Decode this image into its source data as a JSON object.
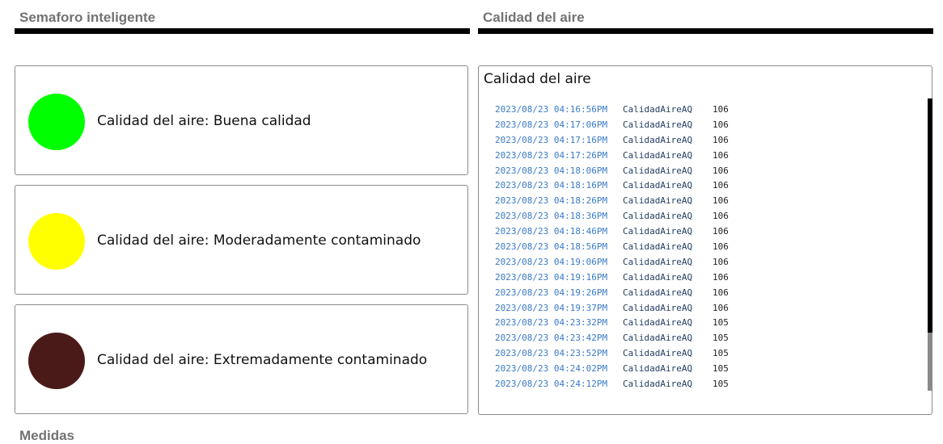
{
  "sections": {
    "left_title": "Semaforo inteligente",
    "right_title": "Calidad del aire",
    "bottom_title": "Medidas"
  },
  "traffic_light": [
    {
      "color": "#00ff00",
      "label": "Calidad del aire: Buena calidad"
    },
    {
      "color": "#ffff00",
      "label": "Calidad del aire: Moderadamente contaminado"
    },
    {
      "color": "#4a1a19",
      "label": "Calidad del aire: Extremadamente contaminado"
    }
  ],
  "log": {
    "title": "Calidad del aire",
    "rows": [
      {
        "ts": "2023/08/23 04:16:56PM",
        "name": "CalidadAireAQ",
        "value": "106"
      },
      {
        "ts": "2023/08/23 04:17:06PM",
        "name": "CalidadAireAQ",
        "value": "106"
      },
      {
        "ts": "2023/08/23 04:17:16PM",
        "name": "CalidadAireAQ",
        "value": "106"
      },
      {
        "ts": "2023/08/23 04:17:26PM",
        "name": "CalidadAireAQ",
        "value": "106"
      },
      {
        "ts": "2023/08/23 04:18:06PM",
        "name": "CalidadAireAQ",
        "value": "106"
      },
      {
        "ts": "2023/08/23 04:18:16PM",
        "name": "CalidadAireAQ",
        "value": "106"
      },
      {
        "ts": "2023/08/23 04:18:26PM",
        "name": "CalidadAireAQ",
        "value": "106"
      },
      {
        "ts": "2023/08/23 04:18:36PM",
        "name": "CalidadAireAQ",
        "value": "106"
      },
      {
        "ts": "2023/08/23 04:18:46PM",
        "name": "CalidadAireAQ",
        "value": "106"
      },
      {
        "ts": "2023/08/23 04:18:56PM",
        "name": "CalidadAireAQ",
        "value": "106"
      },
      {
        "ts": "2023/08/23 04:19:06PM",
        "name": "CalidadAireAQ",
        "value": "106"
      },
      {
        "ts": "2023/08/23 04:19:16PM",
        "name": "CalidadAireAQ",
        "value": "106"
      },
      {
        "ts": "2023/08/23 04:19:26PM",
        "name": "CalidadAireAQ",
        "value": "106"
      },
      {
        "ts": "2023/08/23 04:19:37PM",
        "name": "CalidadAireAQ",
        "value": "106"
      },
      {
        "ts": "2023/08/23 04:23:32PM",
        "name": "CalidadAireAQ",
        "value": "105"
      },
      {
        "ts": "2023/08/23 04:23:42PM",
        "name": "CalidadAireAQ",
        "value": "105"
      },
      {
        "ts": "2023/08/23 04:23:52PM",
        "name": "CalidadAireAQ",
        "value": "105"
      },
      {
        "ts": "2023/08/23 04:24:02PM",
        "name": "CalidadAireAQ",
        "value": "105"
      },
      {
        "ts": "2023/08/23 04:24:12PM",
        "name": "CalidadAireAQ",
        "value": "105"
      }
    ]
  }
}
